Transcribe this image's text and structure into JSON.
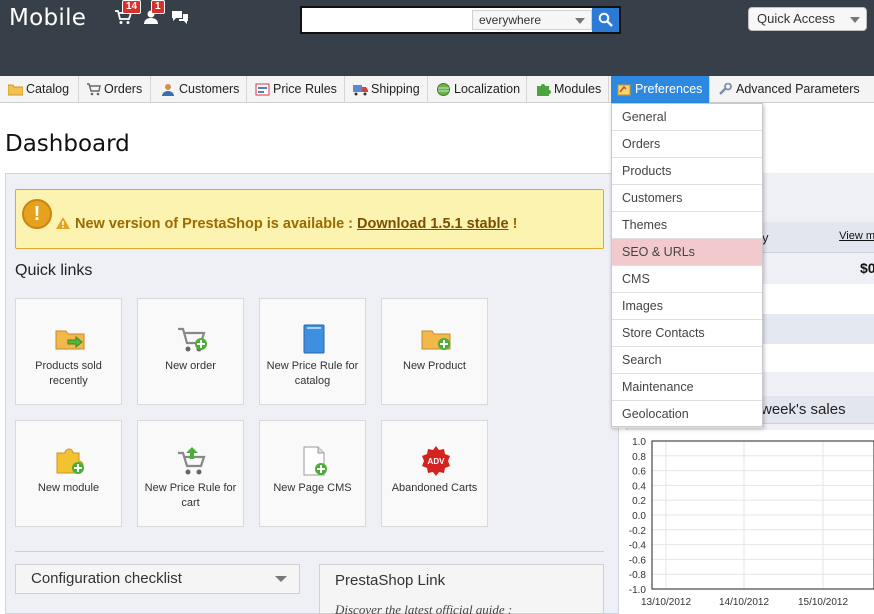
{
  "header": {
    "brand": "Mobile",
    "orders_badge": "14",
    "customers_badge": "1",
    "search": {
      "value": "",
      "scope": "everywhere"
    },
    "quick_access_label": "Quick Access"
  },
  "tabs": [
    {
      "label": "Catalog",
      "icon": "folder-icon"
    },
    {
      "label": "Orders",
      "icon": "cart-icon"
    },
    {
      "label": "Customers",
      "icon": "user-icon"
    },
    {
      "label": "Price Rules",
      "icon": "price-tag-icon"
    },
    {
      "label": "Shipping",
      "icon": "truck-icon"
    },
    {
      "label": "Localization",
      "icon": "globe-icon"
    },
    {
      "label": "Modules",
      "icon": "puzzle-icon"
    },
    {
      "label": "Preferences",
      "icon": "preferences-icon"
    },
    {
      "label": "Advanced Parameters",
      "icon": "wrench-icon"
    }
  ],
  "preferences_menu": [
    "General",
    "Orders",
    "Products",
    "Customers",
    "Themes",
    "SEO & URLs",
    "CMS",
    "Images",
    "Store Contacts",
    "Search",
    "Maintenance",
    "Geolocation"
  ],
  "page_title": "Dashboard",
  "alert": {
    "text": "New version of PrestaShop is available : ",
    "link": "Download 1.5.1 stable",
    "suffix": " !"
  },
  "quick_links": {
    "heading": "Quick links",
    "items": [
      {
        "label": "Products sold recently",
        "icon": "products-sold-icon"
      },
      {
        "label": "New order",
        "icon": "new-order-cart-icon"
      },
      {
        "label": "New Price Rule for catalog",
        "icon": "price-rule-book-icon"
      },
      {
        "label": "New Product",
        "icon": "new-product-icon"
      },
      {
        "label": "New module",
        "icon": "new-module-puzzle-icon"
      },
      {
        "label": "New Price Rule for cart",
        "icon": "price-rule-cart-icon"
      },
      {
        "label": "New Page CMS",
        "icon": "new-page-icon"
      },
      {
        "label": "Abandoned Carts",
        "icon": "adv-badge-icon"
      }
    ]
  },
  "config_checklist": "Configuration checklist",
  "prestashop_link": {
    "title": "PrestaShop Link",
    "subtitle": "Discover the latest official guide :"
  },
  "right_panel": {
    "activity_label": "y",
    "view_more": "View m",
    "value": "$0",
    "sales_title": "week's sales"
  },
  "colors": {
    "header_bg": "#374048",
    "active_tab": "#2d89e0",
    "highlight": "#f2c9cc",
    "alert_bg": "#fdf3b1"
  },
  "chart_data": {
    "type": "line",
    "x": [
      "13/10/2012",
      "14/10/2012",
      "15/10/2012"
    ],
    "y_ticks": [
      "1.0",
      "0.8",
      "0.6",
      "0.4",
      "0.2",
      "0.0",
      "-0.2",
      "-0.4",
      "-0.6",
      "-0.8",
      "-1.0"
    ],
    "ylim": [
      -1.0,
      1.0
    ],
    "series": []
  }
}
